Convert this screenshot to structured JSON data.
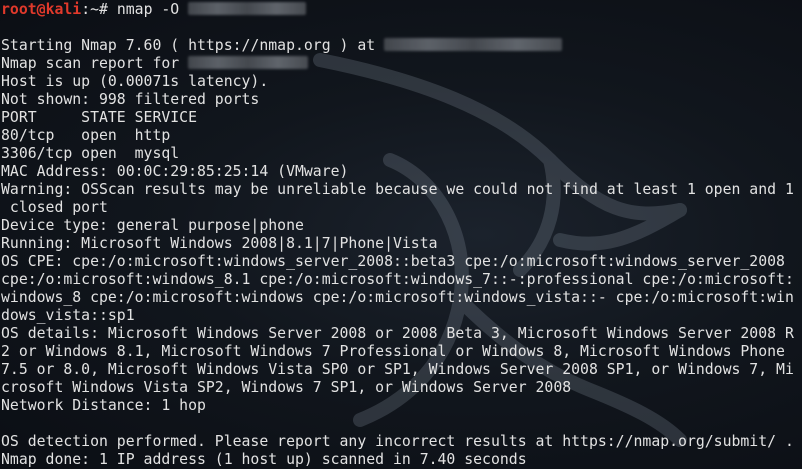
{
  "prompt": {
    "user": "root",
    "at": "@",
    "host": "kali",
    "path": ":~",
    "symbol": "# ",
    "command": "nmap -O "
  },
  "output": {
    "starting": "Starting Nmap 7.60 ( https://nmap.org ) at ",
    "scan_report": "Nmap scan report for ",
    "host_up": "Host is up (0.00071s latency).",
    "not_shown": "Not shown: 998 filtered ports",
    "port_header": "PORT     STATE SERVICE",
    "ports": [
      "80/tcp   open  http",
      "3306/tcp open  mysql"
    ],
    "mac": "MAC Address: 00:0C:29:85:25:14 (VMware)",
    "warning": "Warning: OSScan results may be unreliable because we could not find at least 1 open and 1",
    "warning_cont": " closed port",
    "device_type": "Device type: general purpose|phone",
    "running": "Running: Microsoft Windows 2008|8.1|7|Phone|Vista",
    "os_cpe": [
      "OS CPE: cpe:/o:microsoft:windows_server_2008::beta3 cpe:/o:microsoft:windows_server_2008",
      "cpe:/o:microsoft:windows_8.1 cpe:/o:microsoft:windows_7::-:professional cpe:/o:microsoft:",
      "windows_8 cpe:/o:microsoft:windows cpe:/o:microsoft:windows_vista::- cpe:/o:microsoft:win",
      "dows_vista::sp1"
    ],
    "os_details": [
      "OS details: Microsoft Windows Server 2008 or 2008 Beta 3, Microsoft Windows Server 2008 R",
      "2 or Windows 8.1, Microsoft Windows 7 Professional or Windows 8, Microsoft Windows Phone",
      "7.5 or 8.0, Microsoft Windows Vista SP0 or SP1, Windows Server 2008 SP1, or Windows 7, Mi",
      "crosoft Windows Vista SP2, Windows 7 SP1, or Windows Server 2008"
    ],
    "network_distance": "Network Distance: 1 hop",
    "os_detection": "OS detection performed. Please report any incorrect results at https://nmap.org/submit/ .",
    "done": "Nmap done: 1 IP address (1 host up) scanned in 7.40 seconds"
  },
  "colors": {
    "background": "#0b0e14",
    "text": "#e2e2e2",
    "prompt": "#e0392b"
  }
}
